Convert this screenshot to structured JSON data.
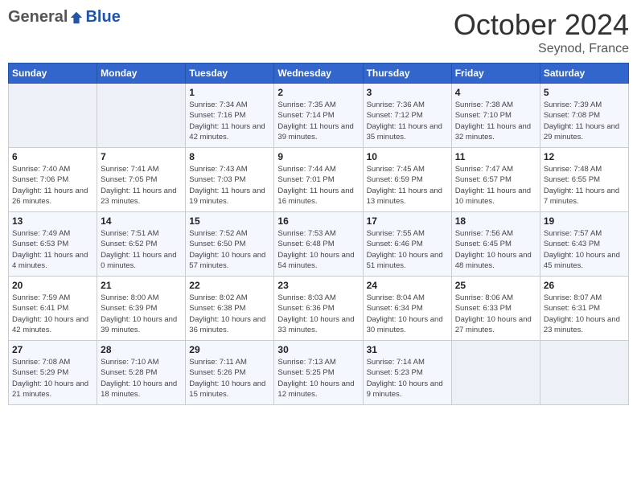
{
  "header": {
    "logo_general": "General",
    "logo_blue": "Blue",
    "month_title": "October 2024",
    "subtitle": "Seynod, France"
  },
  "weekdays": [
    "Sunday",
    "Monday",
    "Tuesday",
    "Wednesday",
    "Thursday",
    "Friday",
    "Saturday"
  ],
  "weeks": [
    [
      {
        "day": "",
        "info": ""
      },
      {
        "day": "",
        "info": ""
      },
      {
        "day": "1",
        "info": "Sunrise: 7:34 AM\nSunset: 7:16 PM\nDaylight: 11 hours and 42 minutes."
      },
      {
        "day": "2",
        "info": "Sunrise: 7:35 AM\nSunset: 7:14 PM\nDaylight: 11 hours and 39 minutes."
      },
      {
        "day": "3",
        "info": "Sunrise: 7:36 AM\nSunset: 7:12 PM\nDaylight: 11 hours and 35 minutes."
      },
      {
        "day": "4",
        "info": "Sunrise: 7:38 AM\nSunset: 7:10 PM\nDaylight: 11 hours and 32 minutes."
      },
      {
        "day": "5",
        "info": "Sunrise: 7:39 AM\nSunset: 7:08 PM\nDaylight: 11 hours and 29 minutes."
      }
    ],
    [
      {
        "day": "6",
        "info": "Sunrise: 7:40 AM\nSunset: 7:06 PM\nDaylight: 11 hours and 26 minutes."
      },
      {
        "day": "7",
        "info": "Sunrise: 7:41 AM\nSunset: 7:05 PM\nDaylight: 11 hours and 23 minutes."
      },
      {
        "day": "8",
        "info": "Sunrise: 7:43 AM\nSunset: 7:03 PM\nDaylight: 11 hours and 19 minutes."
      },
      {
        "day": "9",
        "info": "Sunrise: 7:44 AM\nSunset: 7:01 PM\nDaylight: 11 hours and 16 minutes."
      },
      {
        "day": "10",
        "info": "Sunrise: 7:45 AM\nSunset: 6:59 PM\nDaylight: 11 hours and 13 minutes."
      },
      {
        "day": "11",
        "info": "Sunrise: 7:47 AM\nSunset: 6:57 PM\nDaylight: 11 hours and 10 minutes."
      },
      {
        "day": "12",
        "info": "Sunrise: 7:48 AM\nSunset: 6:55 PM\nDaylight: 11 hours and 7 minutes."
      }
    ],
    [
      {
        "day": "13",
        "info": "Sunrise: 7:49 AM\nSunset: 6:53 PM\nDaylight: 11 hours and 4 minutes."
      },
      {
        "day": "14",
        "info": "Sunrise: 7:51 AM\nSunset: 6:52 PM\nDaylight: 11 hours and 0 minutes."
      },
      {
        "day": "15",
        "info": "Sunrise: 7:52 AM\nSunset: 6:50 PM\nDaylight: 10 hours and 57 minutes."
      },
      {
        "day": "16",
        "info": "Sunrise: 7:53 AM\nSunset: 6:48 PM\nDaylight: 10 hours and 54 minutes."
      },
      {
        "day": "17",
        "info": "Sunrise: 7:55 AM\nSunset: 6:46 PM\nDaylight: 10 hours and 51 minutes."
      },
      {
        "day": "18",
        "info": "Sunrise: 7:56 AM\nSunset: 6:45 PM\nDaylight: 10 hours and 48 minutes."
      },
      {
        "day": "19",
        "info": "Sunrise: 7:57 AM\nSunset: 6:43 PM\nDaylight: 10 hours and 45 minutes."
      }
    ],
    [
      {
        "day": "20",
        "info": "Sunrise: 7:59 AM\nSunset: 6:41 PM\nDaylight: 10 hours and 42 minutes."
      },
      {
        "day": "21",
        "info": "Sunrise: 8:00 AM\nSunset: 6:39 PM\nDaylight: 10 hours and 39 minutes."
      },
      {
        "day": "22",
        "info": "Sunrise: 8:02 AM\nSunset: 6:38 PM\nDaylight: 10 hours and 36 minutes."
      },
      {
        "day": "23",
        "info": "Sunrise: 8:03 AM\nSunset: 6:36 PM\nDaylight: 10 hours and 33 minutes."
      },
      {
        "day": "24",
        "info": "Sunrise: 8:04 AM\nSunset: 6:34 PM\nDaylight: 10 hours and 30 minutes."
      },
      {
        "day": "25",
        "info": "Sunrise: 8:06 AM\nSunset: 6:33 PM\nDaylight: 10 hours and 27 minutes."
      },
      {
        "day": "26",
        "info": "Sunrise: 8:07 AM\nSunset: 6:31 PM\nDaylight: 10 hours and 23 minutes."
      }
    ],
    [
      {
        "day": "27",
        "info": "Sunrise: 7:08 AM\nSunset: 5:29 PM\nDaylight: 10 hours and 21 minutes."
      },
      {
        "day": "28",
        "info": "Sunrise: 7:10 AM\nSunset: 5:28 PM\nDaylight: 10 hours and 18 minutes."
      },
      {
        "day": "29",
        "info": "Sunrise: 7:11 AM\nSunset: 5:26 PM\nDaylight: 10 hours and 15 minutes."
      },
      {
        "day": "30",
        "info": "Sunrise: 7:13 AM\nSunset: 5:25 PM\nDaylight: 10 hours and 12 minutes."
      },
      {
        "day": "31",
        "info": "Sunrise: 7:14 AM\nSunset: 5:23 PM\nDaylight: 10 hours and 9 minutes."
      },
      {
        "day": "",
        "info": ""
      },
      {
        "day": "",
        "info": ""
      }
    ]
  ]
}
